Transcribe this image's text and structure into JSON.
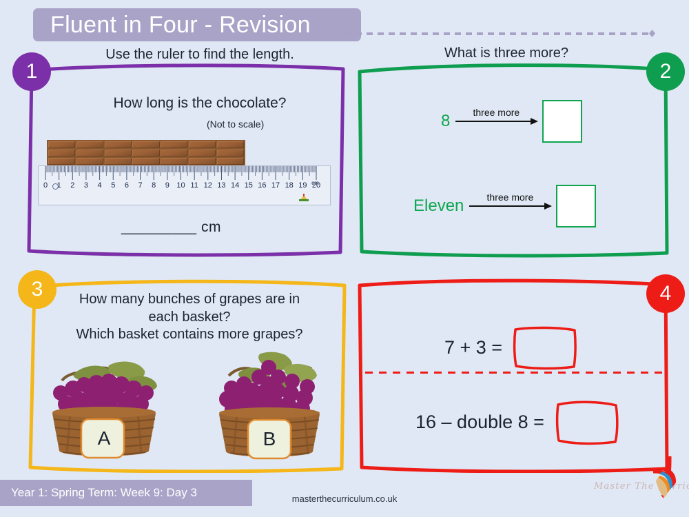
{
  "header": {
    "title": "Fluent in Four - Revision"
  },
  "panels": [
    {
      "number": "1",
      "color": "#7b2fa8",
      "title": "Use the ruler to find the length.",
      "subtitle": "How long is the chocolate?",
      "note": "(Not to scale)",
      "answer_line": "_________ cm",
      "ruler": {
        "unit_label": "cm",
        "ticks": [
          "0",
          "1",
          "2",
          "3",
          "4",
          "5",
          "6",
          "7",
          "8",
          "9",
          "10",
          "11",
          "12",
          "13",
          "14",
          "15",
          "16",
          "17",
          "18",
          "19",
          "20"
        ]
      }
    },
    {
      "number": "2",
      "color": "#0f9d4f",
      "title": "What is three more?",
      "rows": [
        {
          "value": "8",
          "operation": "three more",
          "answer": ""
        },
        {
          "value": "Eleven",
          "operation": "three more",
          "answer": ""
        }
      ]
    },
    {
      "number": "3",
      "color": "#f4b619",
      "title_line1": "How many bunches of grapes are in",
      "title_line2": "each basket?",
      "title_line3": "Which basket contains more grapes?",
      "baskets": [
        {
          "label": "A"
        },
        {
          "label": "B"
        }
      ]
    },
    {
      "number": "4",
      "color": "#ee1c16",
      "equations": [
        {
          "text": "7 + 3 =",
          "answer": ""
        },
        {
          "text": "16 – double 8 =",
          "answer": ""
        }
      ]
    }
  ],
  "footer": {
    "banner": "Year 1: Spring Term: Week 9: Day 3",
    "url": "masterthecurriculum.co.uk",
    "brand": "Master The Curriculum"
  },
  "colors": {
    "background": "#dfe8f4",
    "banner": "#aaa3c8",
    "purple": "#7b2fa8",
    "green": "#0f9d4f",
    "yellow": "#f4b619",
    "red": "#ee1c16"
  }
}
